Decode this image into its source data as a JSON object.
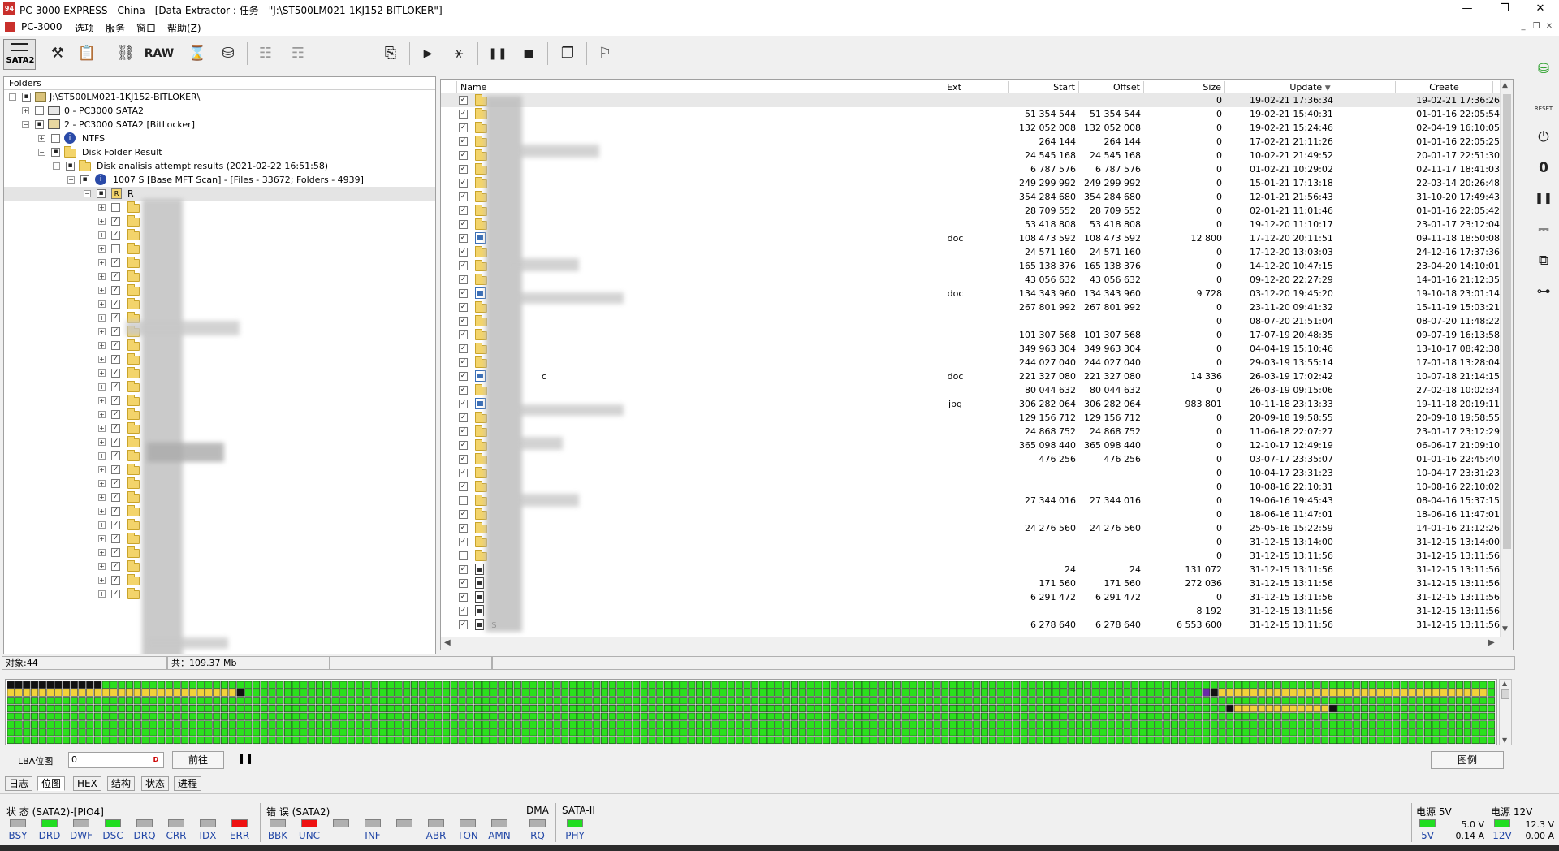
{
  "window": {
    "title": "PC-3000 EXPRESS - China - [Data Extractor : 任务 - \"J:\\ST500LM021-1KJ152-BITLOKER\"]",
    "app_icon": "pc3000-logo-icon",
    "minimize": "—",
    "restore": "❐",
    "close": "✕"
  },
  "menu": {
    "items": [
      "PC-3000",
      "选项",
      "服务",
      "窗口",
      "帮助(Z)"
    ],
    "mdi_controls": [
      "_",
      "❐",
      "✕"
    ]
  },
  "toolbar": {
    "sata_label": "SATA2",
    "raw_label": "RAW",
    "icons": [
      "sata-port-icon",
      "tools-icon",
      "document-list-icon",
      "binoculars-icon",
      "raw-icon",
      "hourglass-icon",
      "disk-export-icon",
      "tree-structure-icon",
      "tree-gray-icon",
      "file-export-icon",
      "play-icon",
      "network-tree-icon",
      "pause-icon",
      "stop-icon",
      "windows-icon",
      "run-exit-icon"
    ]
  },
  "right_toolbar": {
    "icons": [
      "database-icon",
      "reset-icon",
      "power-icon",
      "zero-icon",
      "pause-icon",
      "relay-icon",
      "copy-icon",
      "cable-icon"
    ],
    "reset_label": "RESET"
  },
  "folders": {
    "header": "Folders",
    "root": "J:\\ST500LM021-1KJ152-BITLOKER\\",
    "nodes": [
      "0 - PC3000 SATA2",
      "2 - PC3000 SATA2 [BitLocker]",
      "NTFS",
      "Disk Folder Result",
      "Disk analisis attempt results (2021-02-22 16:51:58)",
      "1007 S [Base MFT Scan] - [Files - 33672; Folders - 4939]",
      "R"
    ]
  },
  "filelist": {
    "columns": {
      "name": "Name",
      "ext": "Ext",
      "start": "Start",
      "offset": "Offset",
      "size": "Size",
      "update": "Update",
      "create": "Create"
    },
    "rows": [
      {
        "ext": "",
        "start": "",
        "offset": "",
        "size": "0",
        "update": "19-02-21 17:36:34",
        "create": "19-02-21 17:36:26",
        "icon": "folder",
        "checked": true
      },
      {
        "ext": "",
        "start": "51 354 544",
        "offset": "51 354 544",
        "size": "0",
        "update": "19-02-21 15:40:31",
        "create": "01-01-16 22:05:54",
        "icon": "folder",
        "checked": true
      },
      {
        "ext": "",
        "start": "132 052 008",
        "offset": "132 052 008",
        "size": "0",
        "update": "19-02-21 15:24:46",
        "create": "02-04-19 16:10:05",
        "icon": "folder",
        "checked": true
      },
      {
        "ext": "",
        "start": "264 144",
        "offset": "264 144",
        "size": "0",
        "update": "17-02-21 21:11:26",
        "create": "01-01-16 22:05:25",
        "icon": "folder",
        "checked": true
      },
      {
        "ext": "",
        "start": "24 545 168",
        "offset": "24 545 168",
        "size": "0",
        "update": "10-02-21 21:49:52",
        "create": "20-01-17 22:51:30",
        "icon": "folder",
        "checked": true
      },
      {
        "ext": "",
        "start": "6 787 576",
        "offset": "6 787 576",
        "size": "0",
        "update": "01-02-21 10:29:02",
        "create": "02-11-17 18:41:03",
        "icon": "folder",
        "checked": true
      },
      {
        "ext": "",
        "start": "249 299 992",
        "offset": "249 299 992",
        "size": "0",
        "update": "15-01-21 17:13:18",
        "create": "22-03-14 20:26:48",
        "icon": "folder",
        "checked": true
      },
      {
        "ext": "",
        "start": "354 284 680",
        "offset": "354 284 680",
        "size": "0",
        "update": "12-01-21 21:56:43",
        "create": "31-10-20 17:49:43",
        "icon": "folder",
        "checked": true
      },
      {
        "ext": "",
        "start": "28 709 552",
        "offset": "28 709 552",
        "size": "0",
        "update": "02-01-21 11:01:46",
        "create": "01-01-16 22:05:42",
        "icon": "folder",
        "checked": true
      },
      {
        "ext": "",
        "start": "53 418 808",
        "offset": "53 418 808",
        "size": "0",
        "update": "19-12-20 11:10:17",
        "create": "23-01-17 23:12:04",
        "icon": "folder",
        "checked": true
      },
      {
        "ext": "doc",
        "start": "108 473 592",
        "offset": "108 473 592",
        "size": "12 800",
        "update": "17-12-20 20:11:51",
        "create": "09-11-18 18:50:08",
        "icon": "doc",
        "checked": true
      },
      {
        "ext": "",
        "start": "24 571 160",
        "offset": "24 571 160",
        "size": "0",
        "update": "17-12-20 13:03:03",
        "create": "24-12-16 17:37:36",
        "icon": "folder",
        "checked": true
      },
      {
        "ext": "",
        "start": "165 138 376",
        "offset": "165 138 376",
        "size": "0",
        "update": "14-12-20 10:47:15",
        "create": "23-04-20 14:10:01",
        "icon": "folder",
        "checked": true
      },
      {
        "ext": "",
        "start": "43 056 632",
        "offset": "43 056 632",
        "size": "0",
        "update": "09-12-20 22:27:29",
        "create": "14-01-16 21:12:35",
        "icon": "folder",
        "checked": true
      },
      {
        "ext": "doc",
        "start": "134 343 960",
        "offset": "134 343 960",
        "size": "9 728",
        "update": "03-12-20 19:45:20",
        "create": "19-10-18 23:01:14",
        "icon": "doc",
        "checked": true
      },
      {
        "ext": "",
        "start": "267 801 992",
        "offset": "267 801 992",
        "size": "0",
        "update": "23-11-20 09:41:32",
        "create": "15-11-19 15:03:21",
        "icon": "folder",
        "checked": true
      },
      {
        "ext": "",
        "start": "",
        "offset": "",
        "size": "0",
        "update": "08-07-20 21:51:04",
        "create": "08-07-20 11:48:22",
        "icon": "folder",
        "checked": true
      },
      {
        "ext": "",
        "start": "101 307 568",
        "offset": "101 307 568",
        "size": "0",
        "update": "17-07-19 20:48:35",
        "create": "09-07-19 16:13:58",
        "icon": "folder",
        "checked": true
      },
      {
        "ext": "",
        "start": "349 963 304",
        "offset": "349 963 304",
        "size": "0",
        "update": "04-04-19 15:10:46",
        "create": "13-10-17 08:42:38",
        "icon": "folder",
        "checked": true
      },
      {
        "ext": "",
        "start": "244 027 040",
        "offset": "244 027 040",
        "size": "0",
        "update": "29-03-19 13:55:14",
        "create": "17-01-18 13:28:04",
        "icon": "folder",
        "checked": true
      },
      {
        "ext": "doc",
        "start": "221 327 080",
        "offset": "221 327 080",
        "size": "14 336",
        "update": "26-03-19 17:02:42",
        "create": "10-07-18 21:14:15",
        "icon": "doc",
        "checked": true,
        "name_suffix": "c"
      },
      {
        "ext": "",
        "start": "80 044 632",
        "offset": "80 044 632",
        "size": "0",
        "update": "26-03-19 09:15:06",
        "create": "27-02-18 10:02:34",
        "icon": "folder",
        "checked": true
      },
      {
        "ext": "jpg",
        "start": "306 282 064",
        "offset": "306 282 064",
        "size": "983 801",
        "update": "10-11-18 23:13:33",
        "create": "19-11-18 20:19:11",
        "icon": "doc",
        "checked": true
      },
      {
        "ext": "",
        "start": "129 156 712",
        "offset": "129 156 712",
        "size": "0",
        "update": "20-09-18 19:58:55",
        "create": "20-09-18 19:58:55",
        "icon": "folder",
        "checked": true
      },
      {
        "ext": "",
        "start": "24 868 752",
        "offset": "24 868 752",
        "size": "0",
        "update": "11-06-18 22:07:27",
        "create": "23-01-17 23:12:29",
        "icon": "folder",
        "checked": true
      },
      {
        "ext": "",
        "start": "365 098 440",
        "offset": "365 098 440",
        "size": "0",
        "update": "12-10-17 12:49:19",
        "create": "06-06-17 21:09:10",
        "icon": "folder",
        "checked": true
      },
      {
        "ext": "",
        "start": "476 256",
        "offset": "476 256",
        "size": "0",
        "update": "03-07-17 23:35:07",
        "create": "01-01-16 22:45:40",
        "icon": "folder",
        "checked": true
      },
      {
        "ext": "",
        "start": "",
        "offset": "",
        "size": "0",
        "update": "10-04-17 23:31:23",
        "create": "10-04-17 23:31:23",
        "icon": "folder",
        "checked": true
      },
      {
        "ext": "",
        "start": "",
        "offset": "",
        "size": "0",
        "update": "10-08-16 22:10:31",
        "create": "10-08-16 22:10:02",
        "icon": "folder",
        "checked": true
      },
      {
        "ext": "",
        "start": "27 344 016",
        "offset": "27 344 016",
        "size": "0",
        "update": "19-06-16 19:45:43",
        "create": "08-04-16 15:37:15",
        "icon": "folder",
        "checked": false
      },
      {
        "ext": "",
        "start": "",
        "offset": "",
        "size": "0",
        "update": "18-06-16 11:47:01",
        "create": "18-06-16 11:47:01",
        "icon": "folder",
        "checked": true
      },
      {
        "ext": "",
        "start": "24 276 560",
        "offset": "24 276 560",
        "size": "0",
        "update": "25-05-16 15:22:59",
        "create": "14-01-16 21:12:26",
        "icon": "folder",
        "checked": true
      },
      {
        "ext": "",
        "start": "",
        "offset": "",
        "size": "0",
        "update": "31-12-15 13:14:00",
        "create": "31-12-15 13:14:00",
        "icon": "folder",
        "checked": true
      },
      {
        "ext": "",
        "start": "",
        "offset": "",
        "size": "0",
        "update": "31-12-15 13:11:56",
        "create": "31-12-15 13:11:56",
        "icon": "folder",
        "checked": false
      },
      {
        "ext": "",
        "start": "24",
        "offset": "24",
        "size": "131 072",
        "update": "31-12-15 13:11:56",
        "create": "31-12-15 13:11:56",
        "icon": "file",
        "checked": true
      },
      {
        "ext": "",
        "start": "171 560",
        "offset": "171 560",
        "size": "272 036",
        "update": "31-12-15 13:11:56",
        "create": "31-12-15 13:11:56",
        "icon": "file",
        "checked": true
      },
      {
        "ext": "",
        "start": "6 291 472",
        "offset": "6 291 472",
        "size": "0",
        "update": "31-12-15 13:11:56",
        "create": "31-12-15 13:11:56",
        "icon": "file",
        "checked": true
      },
      {
        "ext": "",
        "start": "",
        "offset": "",
        "size": "8 192",
        "update": "31-12-15 13:11:56",
        "create": "31-12-15 13:11:56",
        "icon": "file",
        "checked": true
      },
      {
        "ext": "",
        "start": "6 278 640",
        "offset": "6 278 640",
        "size": "6 553 600",
        "update": "31-12-15 13:11:56",
        "create": "31-12-15 13:11:56",
        "icon": "file",
        "checked": true,
        "name_suffix": "$"
      }
    ]
  },
  "status": {
    "objects": "对象:44",
    "total": "共：109.37 Mb"
  },
  "lba": {
    "label": "LBA位图",
    "value": "0",
    "go_button": "前往",
    "legend_button": "图例"
  },
  "tabs": [
    "日志",
    "位图",
    "HEX",
    "结构",
    "状态",
    "进程"
  ],
  "indicators": {
    "status_title": "状 态 (SATA2)-[PIO4]",
    "status_leds": [
      {
        "label": "BSY",
        "color": "#b0b0b0"
      },
      {
        "label": "DRD",
        "color": "#22dd22"
      },
      {
        "label": "DWF",
        "color": "#b0b0b0"
      },
      {
        "label": "DSC",
        "color": "#22dd22"
      },
      {
        "label": "DRQ",
        "color": "#b0b0b0"
      },
      {
        "label": "CRR",
        "color": "#b0b0b0"
      },
      {
        "label": "IDX",
        "color": "#b0b0b0"
      },
      {
        "label": "ERR",
        "color": "#ee1111"
      }
    ],
    "error_title": "错 误 (SATA2)",
    "error_leds": [
      {
        "label": "BBK",
        "color": "#b0b0b0"
      },
      {
        "label": "UNC",
        "color": "#ee1111"
      },
      {
        "label": "",
        "color": "#b0b0b0"
      },
      {
        "label": "INF",
        "color": "#b0b0b0"
      },
      {
        "label": "",
        "color": "#b0b0b0"
      },
      {
        "label": "ABR",
        "color": "#b0b0b0"
      },
      {
        "label": "TON",
        "color": "#b0b0b0"
      },
      {
        "label": "AMN",
        "color": "#b0b0b0"
      }
    ],
    "dma_title": "DMA",
    "dma_leds": [
      {
        "label": "RQ",
        "color": "#b0b0b0"
      }
    ],
    "sata_title": "SATA-II",
    "sata_leds": [
      {
        "label": "PHY",
        "color": "#22dd22"
      }
    ],
    "power5": {
      "title": "电源 5V",
      "label": "5V",
      "voltage": "5.0 V",
      "current": "0.14 A",
      "color": "#22dd22"
    },
    "power12": {
      "title": "电源 12V",
      "label": "12V",
      "voltage": "12.3 V",
      "current": "0.00 A",
      "color": "#22dd22"
    }
  },
  "bitmap": {
    "cols": 188,
    "rows": 8,
    "colors": {
      "ok": "#2be01d",
      "black": "#111111",
      "yellow": "#f2d23a",
      "purple": "#6a2aa8",
      "empty": "#ffffff"
    }
  }
}
